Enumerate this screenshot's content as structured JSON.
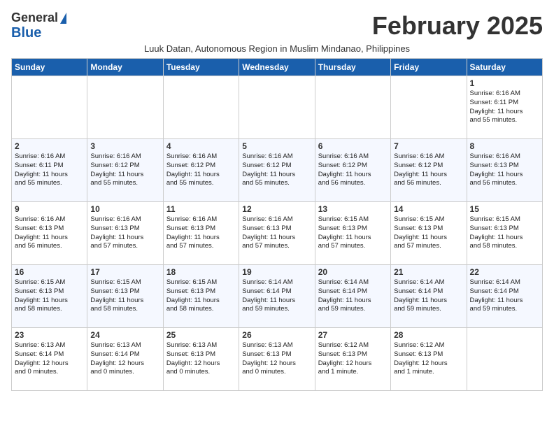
{
  "logo": {
    "line1": "General",
    "line2": "Blue"
  },
  "title": "February 2025",
  "subtitle": "Luuk Datan, Autonomous Region in Muslim Mindanao, Philippines",
  "days_of_week": [
    "Sunday",
    "Monday",
    "Tuesday",
    "Wednesday",
    "Thursday",
    "Friday",
    "Saturday"
  ],
  "weeks": [
    {
      "cells": [
        {
          "day": null,
          "info": ""
        },
        {
          "day": null,
          "info": ""
        },
        {
          "day": null,
          "info": ""
        },
        {
          "day": null,
          "info": ""
        },
        {
          "day": null,
          "info": ""
        },
        {
          "day": null,
          "info": ""
        },
        {
          "day": "1",
          "info": "Sunrise: 6:16 AM\nSunset: 6:11 PM\nDaylight: 11 hours\nand 55 minutes."
        }
      ]
    },
    {
      "cells": [
        {
          "day": "2",
          "info": "Sunrise: 6:16 AM\nSunset: 6:11 PM\nDaylight: 11 hours\nand 55 minutes."
        },
        {
          "day": "3",
          "info": "Sunrise: 6:16 AM\nSunset: 6:12 PM\nDaylight: 11 hours\nand 55 minutes."
        },
        {
          "day": "4",
          "info": "Sunrise: 6:16 AM\nSunset: 6:12 PM\nDaylight: 11 hours\nand 55 minutes."
        },
        {
          "day": "5",
          "info": "Sunrise: 6:16 AM\nSunset: 6:12 PM\nDaylight: 11 hours\nand 55 minutes."
        },
        {
          "day": "6",
          "info": "Sunrise: 6:16 AM\nSunset: 6:12 PM\nDaylight: 11 hours\nand 56 minutes."
        },
        {
          "day": "7",
          "info": "Sunrise: 6:16 AM\nSunset: 6:12 PM\nDaylight: 11 hours\nand 56 minutes."
        },
        {
          "day": "8",
          "info": "Sunrise: 6:16 AM\nSunset: 6:13 PM\nDaylight: 11 hours\nand 56 minutes."
        }
      ]
    },
    {
      "cells": [
        {
          "day": "9",
          "info": "Sunrise: 6:16 AM\nSunset: 6:13 PM\nDaylight: 11 hours\nand 56 minutes."
        },
        {
          "day": "10",
          "info": "Sunrise: 6:16 AM\nSunset: 6:13 PM\nDaylight: 11 hours\nand 57 minutes."
        },
        {
          "day": "11",
          "info": "Sunrise: 6:16 AM\nSunset: 6:13 PM\nDaylight: 11 hours\nand 57 minutes."
        },
        {
          "day": "12",
          "info": "Sunrise: 6:16 AM\nSunset: 6:13 PM\nDaylight: 11 hours\nand 57 minutes."
        },
        {
          "day": "13",
          "info": "Sunrise: 6:15 AM\nSunset: 6:13 PM\nDaylight: 11 hours\nand 57 minutes."
        },
        {
          "day": "14",
          "info": "Sunrise: 6:15 AM\nSunset: 6:13 PM\nDaylight: 11 hours\nand 57 minutes."
        },
        {
          "day": "15",
          "info": "Sunrise: 6:15 AM\nSunset: 6:13 PM\nDaylight: 11 hours\nand 58 minutes."
        }
      ]
    },
    {
      "cells": [
        {
          "day": "16",
          "info": "Sunrise: 6:15 AM\nSunset: 6:13 PM\nDaylight: 11 hours\nand 58 minutes."
        },
        {
          "day": "17",
          "info": "Sunrise: 6:15 AM\nSunset: 6:13 PM\nDaylight: 11 hours\nand 58 minutes."
        },
        {
          "day": "18",
          "info": "Sunrise: 6:15 AM\nSunset: 6:13 PM\nDaylight: 11 hours\nand 58 minutes."
        },
        {
          "day": "19",
          "info": "Sunrise: 6:14 AM\nSunset: 6:14 PM\nDaylight: 11 hours\nand 59 minutes."
        },
        {
          "day": "20",
          "info": "Sunrise: 6:14 AM\nSunset: 6:14 PM\nDaylight: 11 hours\nand 59 minutes."
        },
        {
          "day": "21",
          "info": "Sunrise: 6:14 AM\nSunset: 6:14 PM\nDaylight: 11 hours\nand 59 minutes."
        },
        {
          "day": "22",
          "info": "Sunrise: 6:14 AM\nSunset: 6:14 PM\nDaylight: 11 hours\nand 59 minutes."
        }
      ]
    },
    {
      "cells": [
        {
          "day": "23",
          "info": "Sunrise: 6:13 AM\nSunset: 6:14 PM\nDaylight: 12 hours\nand 0 minutes."
        },
        {
          "day": "24",
          "info": "Sunrise: 6:13 AM\nSunset: 6:14 PM\nDaylight: 12 hours\nand 0 minutes."
        },
        {
          "day": "25",
          "info": "Sunrise: 6:13 AM\nSunset: 6:13 PM\nDaylight: 12 hours\nand 0 minutes."
        },
        {
          "day": "26",
          "info": "Sunrise: 6:13 AM\nSunset: 6:13 PM\nDaylight: 12 hours\nand 0 minutes."
        },
        {
          "day": "27",
          "info": "Sunrise: 6:12 AM\nSunset: 6:13 PM\nDaylight: 12 hours\nand 1 minute."
        },
        {
          "day": "28",
          "info": "Sunrise: 6:12 AM\nSunset: 6:13 PM\nDaylight: 12 hours\nand 1 minute."
        },
        {
          "day": null,
          "info": ""
        }
      ]
    }
  ]
}
